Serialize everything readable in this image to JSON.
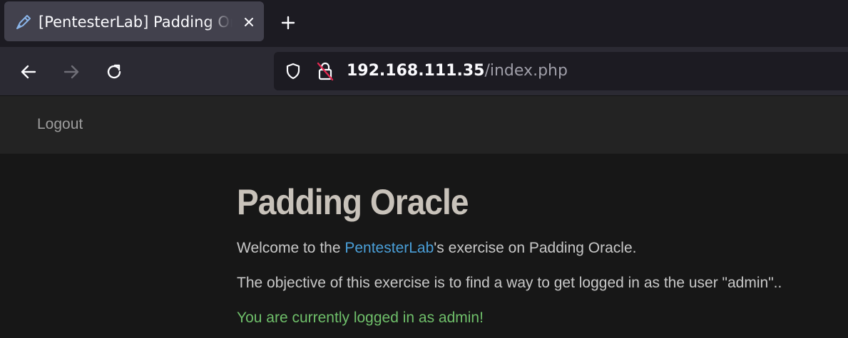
{
  "browser": {
    "tab": {
      "title": "[PentesterLab] Padding Oracle",
      "favicon": "pen-icon"
    },
    "new_tab_label": "+",
    "address": {
      "host": "192.168.111.35",
      "path": "/index.php"
    }
  },
  "page": {
    "nav": {
      "logout_label": "Logout"
    },
    "heading": "Padding Oracle",
    "welcome": {
      "before": "Welcome to the ",
      "link": "PentesterLab",
      "after": "'s exercise on Padding Oracle."
    },
    "objective": "The objective of this exercise is to find a way to get logged in as the user \"admin\"..",
    "status": "You are currently logged in as admin!"
  },
  "colors": {
    "link": "#4a9fd8",
    "success": "#6fbf6a",
    "heading": "#c8c2ba"
  }
}
